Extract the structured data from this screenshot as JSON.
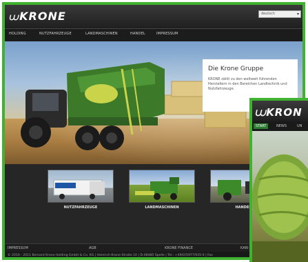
{
  "header": {
    "logo_text": "KRONE",
    "language_select": {
      "value": "deutsch"
    }
  },
  "nav": {
    "items": [
      {
        "label": "HOLDING"
      },
      {
        "label": "NUTZFAHRZEUGE"
      },
      {
        "label": "LANDMASCHINEN"
      },
      {
        "label": "HANDEL"
      },
      {
        "label": "IMPRESSUM"
      }
    ]
  },
  "hero": {
    "info_title": "Die Krone Gruppe",
    "info_text": "KRONE zählt zu den weltweit führenden Herstellern in den Bereichen Landtechnik und Nutzfahrzeuge."
  },
  "teasers": [
    {
      "label": "NUTZFAHRZEUGE"
    },
    {
      "label": "LANDMASCHINEN"
    },
    {
      "label": "HANDEL"
    }
  ],
  "footer": {
    "links": [
      {
        "label": "IMPRESSUM"
      },
      {
        "label": "AGB"
      },
      {
        "label": "KRONE FINANCE"
      },
      {
        "label": "KARI"
      }
    ],
    "copyright": "© 2010 - 2011 Bernard Krone Holding GmbH & Co. KG | Heinrich-Krone-Straße 10 | D-48480 Spelle | Tel.: +49(0)5977/935-0 | Fax"
  },
  "overlay": {
    "logo_text": "KRON",
    "tabs": [
      {
        "label": "START",
        "active": true
      },
      {
        "label": "NEWS",
        "active": false
      },
      {
        "label": "UN",
        "active": false
      }
    ]
  },
  "colors": {
    "frame_green": "#3fb22f",
    "krone_green": "#2e7d32",
    "header_dark": "#1f1f1f"
  }
}
